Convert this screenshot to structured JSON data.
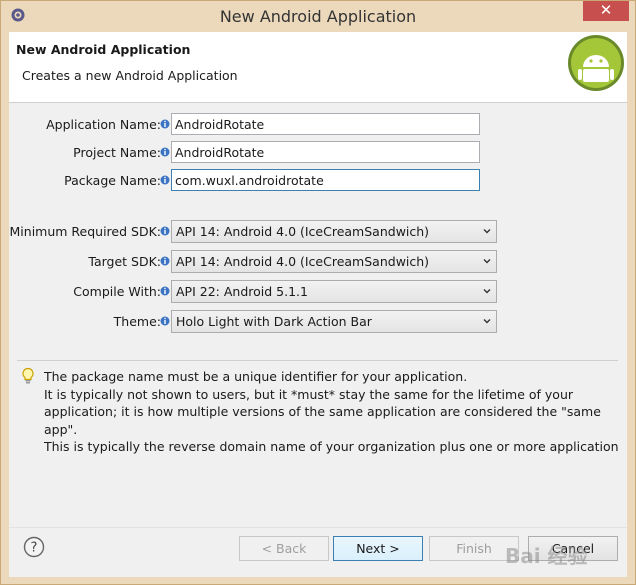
{
  "window": {
    "title": "New Android Application",
    "close_glyph": "✕"
  },
  "banner": {
    "title": "New Android Application",
    "description": "Creates a new Android Application",
    "logo_icon": "android-logo-icon"
  },
  "form": {
    "application_name": {
      "label": "Application Name:",
      "value": "AndroidRotate"
    },
    "project_name": {
      "label": "Project Name:",
      "value": "AndroidRotate"
    },
    "package_name": {
      "label": "Package Name:",
      "value": "com.wuxl.androidrotate"
    },
    "min_sdk": {
      "label": "Minimum Required SDK:",
      "value": "API 14: Android 4.0 (IceCreamSandwich)"
    },
    "target_sdk": {
      "label": "Target SDK:",
      "value": "API 14: Android 4.0 (IceCreamSandwich)"
    },
    "compile_with": {
      "label": "Compile With:",
      "value": "API 22: Android 5.1.1"
    },
    "theme": {
      "label": "Theme:",
      "value": "Holo Light with Dark Action Bar"
    }
  },
  "hint": {
    "icon": "lightbulb-icon",
    "lines": [
      "The package name must be a unique identifier for your application.",
      "It is typically not shown to users, but it *must* stay the same for the lifetime of your application; it is how multiple versions of the same application are considered the \"same app\".",
      "This is typically the reverse domain name of your organization plus one or more application"
    ]
  },
  "buttons": {
    "back": "< Back",
    "next": "Next >",
    "finish": "Finish",
    "cancel": "Cancel"
  },
  "watermark": "Bai 经验",
  "colors": {
    "close": "#c7504f",
    "frame": "#ecd9bc",
    "focus": "#3c7fb1",
    "android_green": "#a4c639"
  }
}
